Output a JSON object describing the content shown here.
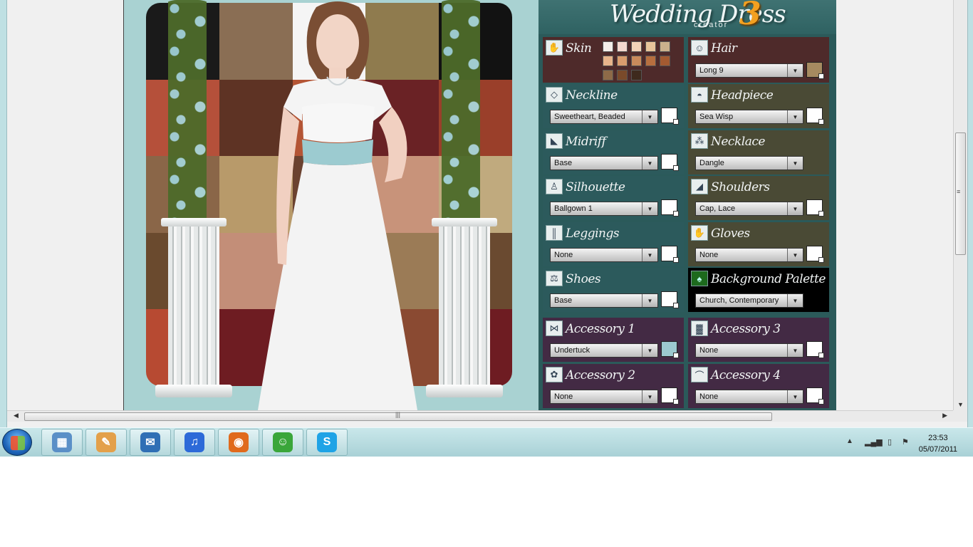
{
  "dress_creator": {
    "logo_title": "Wedding Dress",
    "logo_sub": "creator",
    "logo_num": "3",
    "panels": {
      "skin": {
        "label": "Skin"
      },
      "hair": {
        "label": "Hair",
        "value": "Long 9",
        "swatch": "#a68a60"
      },
      "neckline": {
        "label": "Neckline",
        "value": "Sweetheart, Beaded",
        "swatch": "#ffffff"
      },
      "headpiece": {
        "label": "Headpiece",
        "value": "Sea Wisp",
        "swatch": "#ffffff"
      },
      "midriff": {
        "label": "Midriff",
        "value": "Base",
        "swatch": "#ffffff"
      },
      "necklace": {
        "label": "Necklace",
        "value": "Dangle"
      },
      "silhouette": {
        "label": "Silhouette",
        "value": "Ballgown 1",
        "swatch": "#ffffff"
      },
      "shoulders": {
        "label": "Shoulders",
        "value": "Cap, Lace",
        "swatch": "#ffffff"
      },
      "leggings": {
        "label": "Leggings",
        "value": "None",
        "swatch": "#ffffff"
      },
      "gloves": {
        "label": "Gloves",
        "value": "None",
        "swatch": "#ffffff"
      },
      "shoes": {
        "label": "Shoes",
        "value": "Base",
        "swatch": "#ffffff"
      },
      "background_palette": {
        "label": "Background Palette",
        "value": "Church, Contemporary"
      },
      "accessory1": {
        "label": "Accessory 1",
        "value": "Undertuck",
        "swatch": "#9cc9cf"
      },
      "accessory3": {
        "label": "Accessory 3",
        "value": "None",
        "swatch": "#ffffff"
      },
      "accessory2": {
        "label": "Accessory 2",
        "value": "None",
        "swatch": "#ffffff"
      },
      "accessory4": {
        "label": "Accessory 4",
        "value": "None",
        "swatch": "#ffffff"
      }
    },
    "skin_swatches": [
      "#f3eee9",
      "#f4d8ce",
      "#f2d3b8",
      "#e6c49a",
      "#cbb18c",
      "#e7b48b",
      "#d99c6d",
      "#c98a5b",
      "#b76f3f",
      "#a45a31",
      "#8d6a48",
      "#7a4a2a",
      "#3e2a1d"
    ]
  },
  "backdrop_colors": [
    "#1a1a1a",
    "#8a6e54",
    "#f5f5f5",
    "#8f7b4e",
    "#121212",
    "#b5503a",
    "#5e3324",
    "#b45535",
    "#6a2225",
    "#9a3f2a",
    "#8a6648",
    "#b89a6a",
    "#6b4230",
    "#c8937a",
    "#c0aa7e",
    "#6a4a2e",
    "#c38e78",
    "#5c4028",
    "#9b7b56",
    "#6a4a30",
    "#b74a32",
    "#6e1c22",
    "#8a6b4c",
    "#8a4a32",
    "#6e1c22"
  ],
  "taskbar": {
    "apps": [
      {
        "name": "calculator-icon",
        "color": "#5a8fc7",
        "glyph": "▦"
      },
      {
        "name": "paint-icon",
        "color": "#e3a04a",
        "glyph": "✎"
      },
      {
        "name": "thunderbird-icon",
        "color": "#2f6fb5",
        "glyph": "✉"
      },
      {
        "name": "itunes-icon",
        "color": "#2d6ad8",
        "glyph": "♫"
      },
      {
        "name": "firefox-icon",
        "color": "#e06a1c",
        "glyph": "◉"
      },
      {
        "name": "messenger-icon",
        "color": "#3aa63a",
        "glyph": "☺"
      },
      {
        "name": "skype-icon",
        "color": "#1fa3e6",
        "glyph": "S"
      }
    ],
    "time": "23:53",
    "date": "05/07/2011"
  }
}
